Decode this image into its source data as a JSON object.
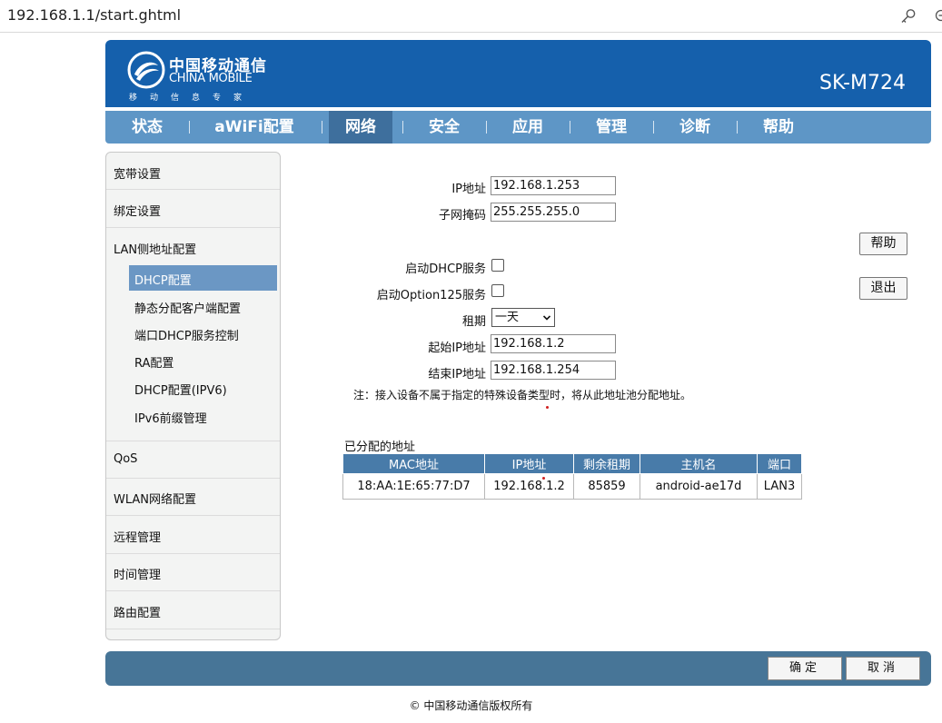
{
  "browser": {
    "url": "192.168.1.1/start.ghtml"
  },
  "header": {
    "logo_cn": "中国移动通信",
    "logo_en": "CHINA MOBILE",
    "logo_slogan": "移动信息专家",
    "model": "SK-M724",
    "color": "#1560ac"
  },
  "nav": {
    "items": [
      "状态",
      "aWiFi配置",
      "网络",
      "安全",
      "应用",
      "管理",
      "诊断",
      "帮助"
    ],
    "active": "网络"
  },
  "sidebar": {
    "items": [
      "宽带设置",
      "绑定设置",
      "LAN侧地址配置",
      "QoS",
      "WLAN网络配置",
      "远程管理",
      "时间管理",
      "路由配置"
    ],
    "sub_items": [
      "DHCP配置",
      "静态分配客户端配置",
      "端口DHCP服务控制",
      "RA配置",
      "DHCP配置(IPV6)",
      "IPv6前缀管理"
    ]
  },
  "form": {
    "ip_label": "IP地址",
    "ip_value": "192.168.1.253",
    "mask_label": "子网掩码",
    "mask_value": "255.255.255.0",
    "dhcp_label": "启动DHCP服务",
    "opt125_label": "启动Option125服务",
    "lease_label": "租期",
    "lease_value": "一天",
    "start_ip_label": "起始IP地址",
    "start_ip_value": "192.168.1.2",
    "end_ip_label": "结束IP地址",
    "end_ip_value": "192.168.1.254",
    "note": "注：接入设备不属于指定的特殊设备类型时，将从此地址池分配地址。"
  },
  "buttons": {
    "help": "帮助",
    "logout": "退出",
    "ok": "确定",
    "cancel": "取消"
  },
  "table": {
    "title": "已分配的地址",
    "headers": [
      "MAC地址",
      "IP地址",
      "剩余租期",
      "主机名",
      "端口"
    ],
    "rows": [
      [
        "18:AA:1E:65:77:D7",
        "192.168.1.2",
        "85859",
        "android-ae17d",
        "LAN3"
      ]
    ]
  },
  "footer": {
    "copyright": "© 中国移动通信版权所有"
  }
}
